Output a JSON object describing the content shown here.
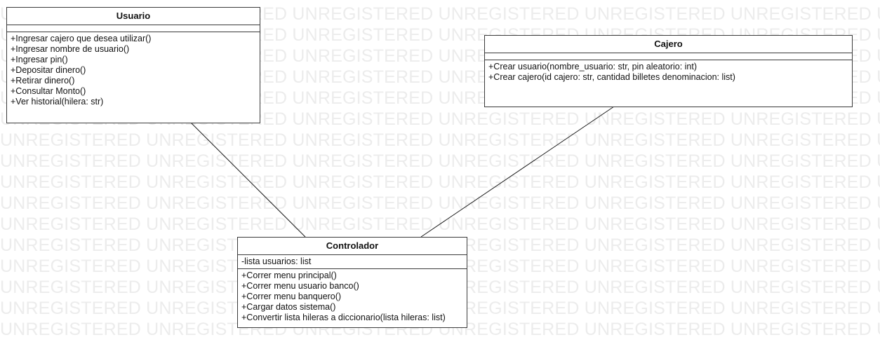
{
  "watermark_text": "UNREGISTERED",
  "classes": {
    "usuario": {
      "name": "Usuario",
      "attributes": [],
      "methods": [
        "+Ingresar cajero que desea utilizar()",
        "+Ingresar nombre de usuario()",
        "+Ingresar pin()",
        "+Depositar dinero()",
        "+Retirar dinero()",
        "+Consultar Monto()",
        "+Ver historial(hilera: str)"
      ]
    },
    "cajero": {
      "name": "Cajero",
      "attributes": [],
      "methods": [
        "+Crear usuario(nombre_usuario: str, pin aleatorio: int)",
        "+Crear cajero(id cajero: str, cantidad billetes denominacion: list)"
      ]
    },
    "controlador": {
      "name": "Controlador",
      "attributes": [
        "-lista usuarios: list"
      ],
      "methods": [
        "+Correr menu principal()",
        "+Correr menu usuario banco()",
        "+Correr menu banquero()",
        "+Cargar datos sistema()",
        "+Convertir lista hileras a diccionario(lista hileras: list)"
      ]
    }
  },
  "associations": [
    {
      "from": "usuario",
      "to": "controlador"
    },
    {
      "from": "cajero",
      "to": "controlador"
    }
  ]
}
